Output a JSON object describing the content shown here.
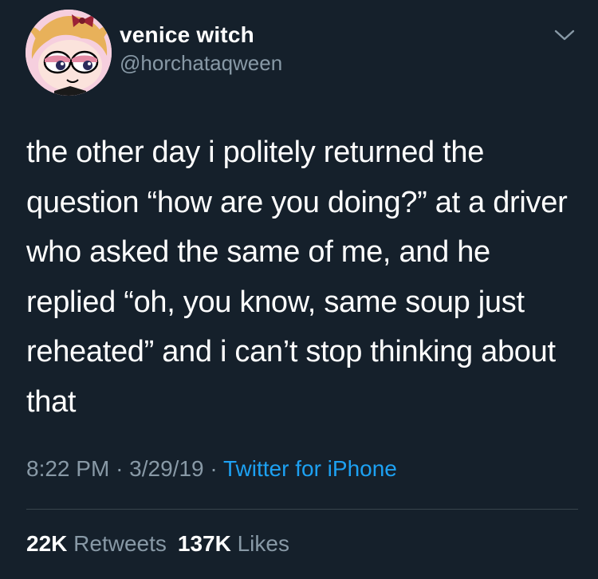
{
  "author": {
    "display_name": "venice witch",
    "handle": "@horchataqween",
    "avatar_icon": "cartoon-girl-avatar-icon"
  },
  "tweet": {
    "text": "the other day i politely returned the question “how are you doing?” at a driver who asked the same of me, and he replied “oh, you know, same soup just reheated” and i can’t stop thinking about that"
  },
  "meta": {
    "time": "8:22 PM",
    "separator": "·",
    "date": "3/29/19",
    "source": "Twitter for iPhone"
  },
  "stats": {
    "retweets_count": "22K",
    "retweets_label": "Retweets",
    "likes_count": "137K",
    "likes_label": "Likes"
  },
  "colors": {
    "background": "#15202b",
    "primary_text": "#ffffff",
    "secondary_text": "#8899a6",
    "link": "#1da1f2",
    "divider": "#38444d"
  }
}
